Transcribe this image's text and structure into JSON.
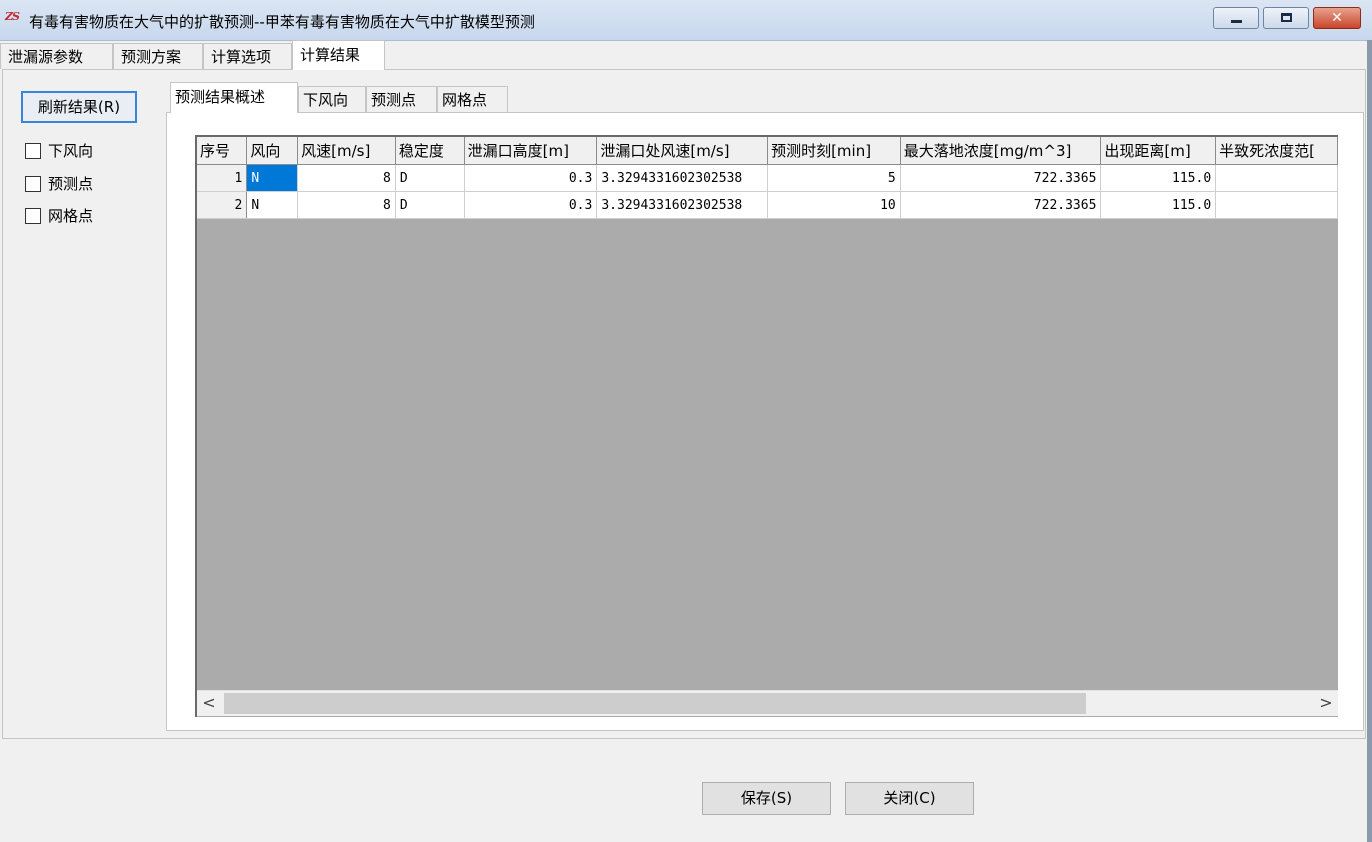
{
  "window": {
    "title": "有毒有害物质在大气中的扩散预测--甲苯有毒有害物质在大气中扩散模型预测",
    "app_icon": "ZS"
  },
  "outer_tabs": [
    {
      "label": "泄漏源参数"
    },
    {
      "label": "预测方案"
    },
    {
      "label": "计算选项"
    },
    {
      "label": "计算结果",
      "active": true
    }
  ],
  "sidebar": {
    "refresh_label": "刷新结果(R)",
    "checkboxes": [
      {
        "label": "下风向",
        "checked": false
      },
      {
        "label": "预测点",
        "checked": false
      },
      {
        "label": "网格点",
        "checked": false
      }
    ]
  },
  "inner_tabs": [
    {
      "label": "预测结果概述",
      "active": true
    },
    {
      "label": "下风向"
    },
    {
      "label": "预测点"
    },
    {
      "label": "网格点"
    }
  ],
  "table": {
    "columns": [
      "序号",
      "风向",
      "风速[m/s]",
      "稳定度",
      "泄漏口高度[m]",
      "泄漏口处风速[m/s]",
      "预测时刻[min]",
      "最大落地浓度[mg/m^3]",
      "出现距离[m]",
      "半致死浓度范["
    ],
    "rows": [
      [
        "1",
        "N",
        "8",
        "D",
        "0.3",
        "3.3294331602302538",
        "5",
        "722.3365",
        "115.0",
        ""
      ],
      [
        "2",
        "N",
        "8",
        "D",
        "0.3",
        "3.3294331602302538",
        "10",
        "722.3365",
        "115.0",
        ""
      ]
    ]
  },
  "scrollbar": {
    "left_arrow": "<",
    "right_arrow": ">"
  },
  "footer": {
    "save_label": "保存(S)",
    "close_label": "关闭(C)"
  }
}
